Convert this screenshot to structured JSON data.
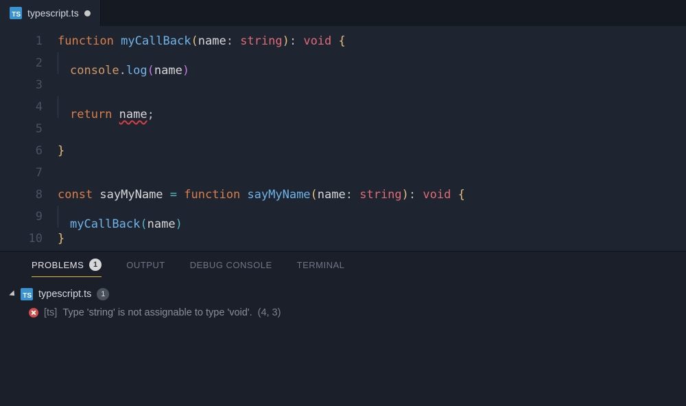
{
  "tab": {
    "filename": "typescript.ts",
    "lang_badge": "TS",
    "dirty": true
  },
  "code": {
    "lines": [
      {
        "n": 1,
        "indent": 0,
        "tokens": [
          {
            "t": "function ",
            "c": "tk-kw"
          },
          {
            "t": "myCallBack",
            "c": "tk-fn"
          },
          {
            "t": "(",
            "c": "tk-br1"
          },
          {
            "t": "name",
            "c": "tk-id"
          },
          {
            "t": ": ",
            "c": "tk-p"
          },
          {
            "t": "string",
            "c": "tk-ty"
          },
          {
            "t": ")",
            "c": "tk-br1"
          },
          {
            "t": ": ",
            "c": "tk-p"
          },
          {
            "t": "void ",
            "c": "tk-ty"
          },
          {
            "t": "{",
            "c": "tk-br1"
          }
        ]
      },
      {
        "n": 2,
        "indent": 1,
        "tokens": [
          {
            "t": "console",
            "c": "tk-obj"
          },
          {
            "t": ".",
            "c": "tk-p"
          },
          {
            "t": "log",
            "c": "tk-fn"
          },
          {
            "t": "(",
            "c": "tk-br2"
          },
          {
            "t": "name",
            "c": "tk-id"
          },
          {
            "t": ")",
            "c": "tk-br2"
          }
        ]
      },
      {
        "n": 3,
        "indent": 0,
        "tokens": []
      },
      {
        "n": 4,
        "indent": 1,
        "tokens": [
          {
            "t": "return",
            "c": "tk-kw"
          },
          {
            "t": " ",
            "c": "tk-p"
          },
          {
            "t": "name",
            "c": "tk-id",
            "err": true
          },
          {
            "t": ";",
            "c": "tk-p"
          }
        ]
      },
      {
        "n": 5,
        "indent": 0,
        "tokens": []
      },
      {
        "n": 6,
        "indent": 0,
        "tokens": [
          {
            "t": "}",
            "c": "tk-br1"
          }
        ]
      },
      {
        "n": 7,
        "indent": 0,
        "tokens": []
      },
      {
        "n": 8,
        "indent": 0,
        "tokens": [
          {
            "t": "const ",
            "c": "tk-kw"
          },
          {
            "t": "sayMyName",
            "c": "tk-id"
          },
          {
            "t": " ",
            "c": "tk-p"
          },
          {
            "t": "=",
            "c": "tk-op"
          },
          {
            "t": " ",
            "c": "tk-p"
          },
          {
            "t": "function ",
            "c": "tk-kw"
          },
          {
            "t": "sayMyName",
            "c": "tk-fn"
          },
          {
            "t": "(",
            "c": "tk-br1"
          },
          {
            "t": "name",
            "c": "tk-id"
          },
          {
            "t": ": ",
            "c": "tk-p"
          },
          {
            "t": "string",
            "c": "tk-ty"
          },
          {
            "t": ")",
            "c": "tk-br1"
          },
          {
            "t": ": ",
            "c": "tk-p"
          },
          {
            "t": "void ",
            "c": "tk-ty"
          },
          {
            "t": "{",
            "c": "tk-br1"
          }
        ]
      },
      {
        "n": 9,
        "indent": 1,
        "tokens": [
          {
            "t": "myCallBack",
            "c": "tk-fn"
          },
          {
            "t": "(",
            "c": "tk-br3"
          },
          {
            "t": "name",
            "c": "tk-id"
          },
          {
            "t": ")",
            "c": "tk-br3"
          }
        ]
      },
      {
        "n": 10,
        "indent": 0,
        "tokens": [
          {
            "t": "}",
            "c": "tk-br1"
          }
        ]
      }
    ]
  },
  "panel": {
    "tabs": {
      "problems": "PROBLEMS",
      "output": "OUTPUT",
      "debug": "DEBUG CONSOLE",
      "terminal": "TERMINAL"
    },
    "problem_count": "1",
    "file": {
      "name": "typescript.ts",
      "count": "1",
      "lang_badge": "TS"
    },
    "error": {
      "source": "[ts]",
      "message": "Type 'string' is not assignable to type 'void'.",
      "location": "(4, 3)"
    }
  }
}
